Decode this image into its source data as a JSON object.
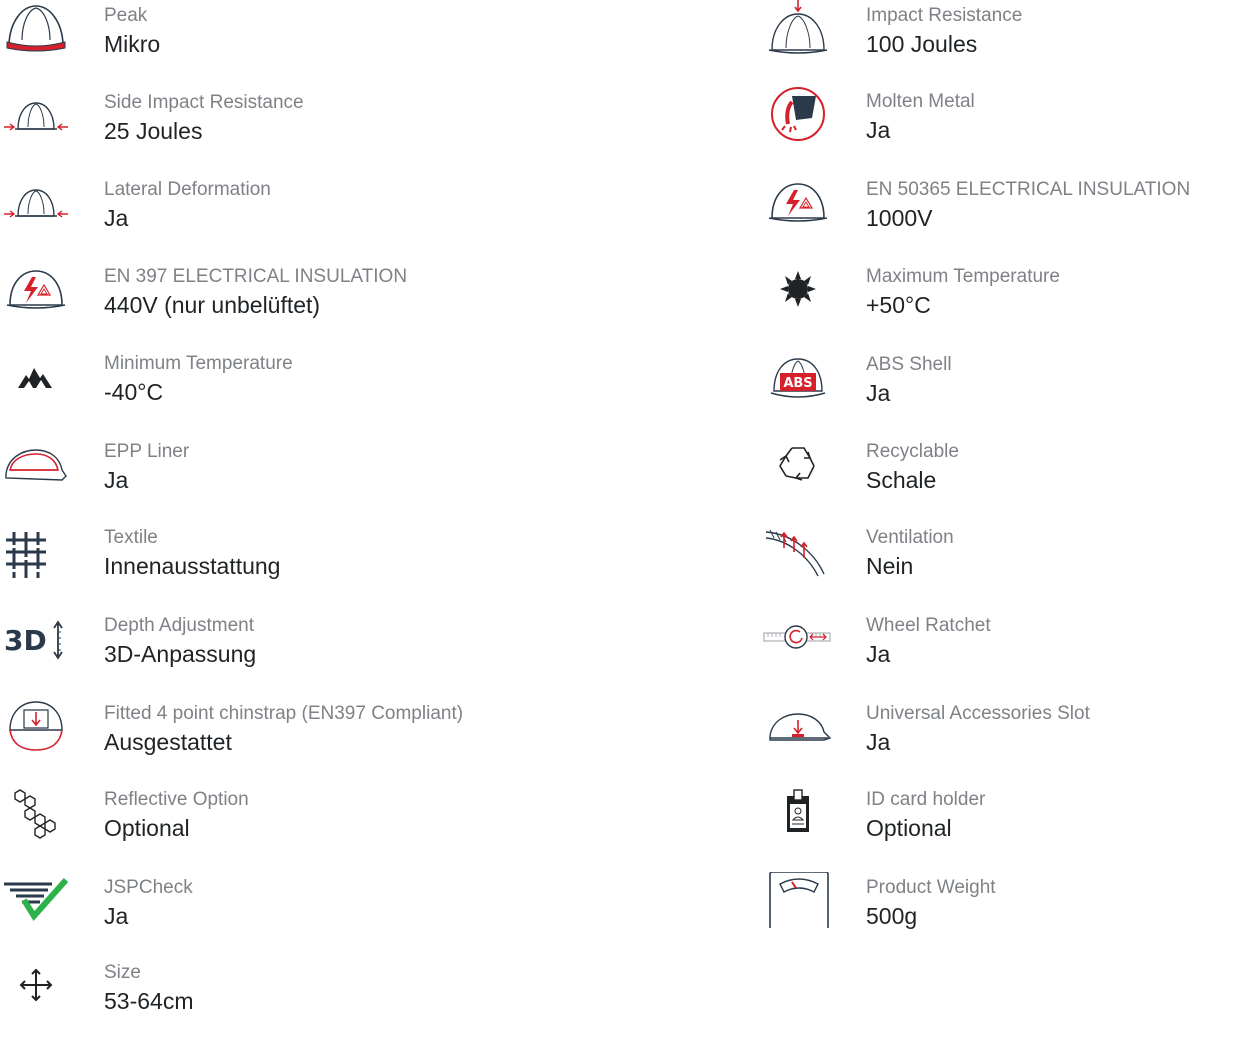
{
  "left": [
    {
      "label": "Peak",
      "value": "Mikro",
      "icon": "helmet-peak-icon"
    },
    {
      "label": "Side Impact Resistance",
      "value": "25 Joules",
      "icon": "side-impact-icon"
    },
    {
      "label": "Lateral Deformation",
      "value": "Ja",
      "icon": "lateral-deformation-icon"
    },
    {
      "label": "EN 397 ELECTRICAL INSULATION",
      "value": "440V (nur unbelüftet)",
      "icon": "electrical-insulation-icon"
    },
    {
      "label": "Minimum Temperature",
      "value": "-40°C",
      "icon": "mountains-icon"
    },
    {
      "label": "EPP Liner",
      "value": "Ja",
      "icon": "epp-liner-icon"
    },
    {
      "label": "Textile",
      "value": "Innenausstattung",
      "icon": "textile-grid-icon"
    },
    {
      "label": "Depth Adjustment",
      "value": "3D-Anpassung",
      "icon": "3d-adjustment-icon"
    },
    {
      "label": "Fitted 4 point chinstrap (EN397 Compliant)",
      "value": "Ausgestattet",
      "icon": "chinstrap-helmet-icon"
    },
    {
      "label": "Reflective Option",
      "value": "Optional",
      "icon": "hexagon-reflective-icon"
    },
    {
      "label": "JSPCheck",
      "value": "Ja",
      "icon": "jspcheck-icon"
    },
    {
      "label": "Size",
      "value": "53-64cm",
      "icon": "size-arrows-icon"
    }
  ],
  "right": [
    {
      "label": "Impact Resistance",
      "value": "100 Joules",
      "icon": "impact-resistance-icon"
    },
    {
      "label": "Molten Metal",
      "value": "Ja",
      "icon": "molten-metal-icon"
    },
    {
      "label": "EN 50365 ELECTRICAL INSULATION",
      "value": "1000V",
      "icon": "electrical-insulation-icon"
    },
    {
      "label": "Maximum Temperature",
      "value": "+50°C",
      "icon": "sun-icon"
    },
    {
      "label": "ABS Shell",
      "value": "Ja",
      "icon": "abs-shell-icon",
      "icon_text": "ABS"
    },
    {
      "label": "Recyclable",
      "value": "Schale",
      "icon": "recycle-icon"
    },
    {
      "label": "Ventilation",
      "value": "Nein",
      "icon": "ventilation-icon"
    },
    {
      "label": "Wheel Ratchet",
      "value": "Ja",
      "icon": "wheel-ratchet-icon"
    },
    {
      "label": "Universal Accessories Slot",
      "value": "Ja",
      "icon": "accessories-slot-icon"
    },
    {
      "label": "ID card holder",
      "value": "Optional",
      "icon": "id-card-holder-icon"
    },
    {
      "label": "Product Weight",
      "value": "500g",
      "icon": "weight-scale-icon"
    }
  ],
  "colors": {
    "accent": "#d6202c",
    "icon_dark": "#2b3a4a",
    "label": "#7e8286",
    "value": "#1f2326",
    "check": "#2db24a"
  }
}
